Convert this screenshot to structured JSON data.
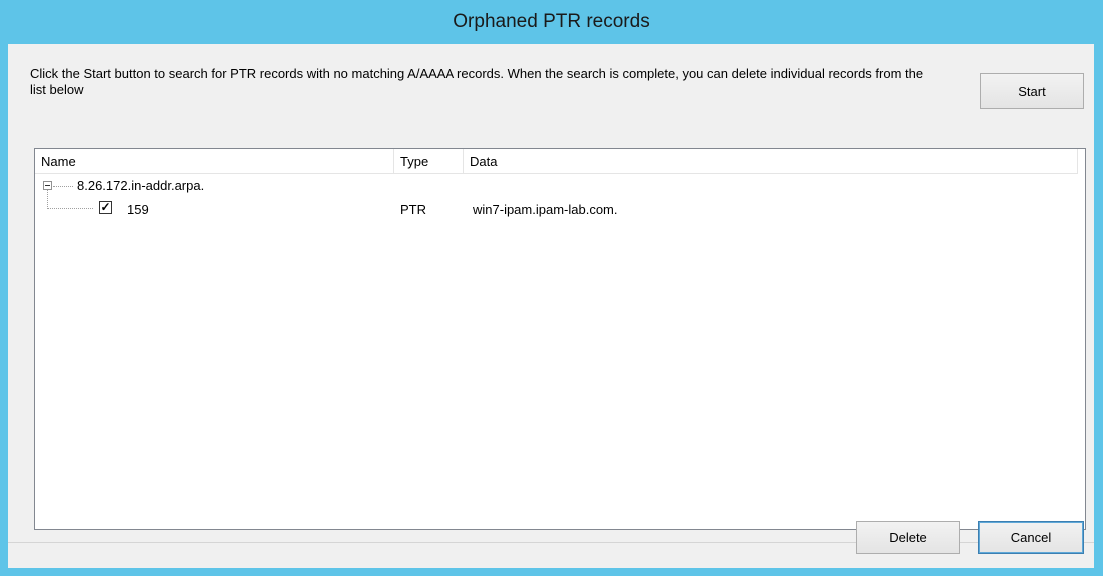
{
  "window": {
    "title": "Orphaned PTR records"
  },
  "description": "Click the Start button to search for PTR records with no matching A/AAAA records.  When the search is complete, you can delete individual records from the list below",
  "buttons": {
    "start": "Start",
    "delete": "Delete",
    "cancel": "Cancel"
  },
  "list": {
    "columns": [
      "Name",
      "Type",
      "Data"
    ],
    "groups": [
      {
        "name": "8.26.172.in-addr.arpa.",
        "expanded": true,
        "records": [
          {
            "name": "159",
            "type": "PTR",
            "data": "win7-ipam.ipam-lab.com.",
            "checked": true
          }
        ]
      }
    ]
  },
  "colors": {
    "title_bar": "#5ec4e8",
    "client_bg": "#f0f0f0"
  }
}
